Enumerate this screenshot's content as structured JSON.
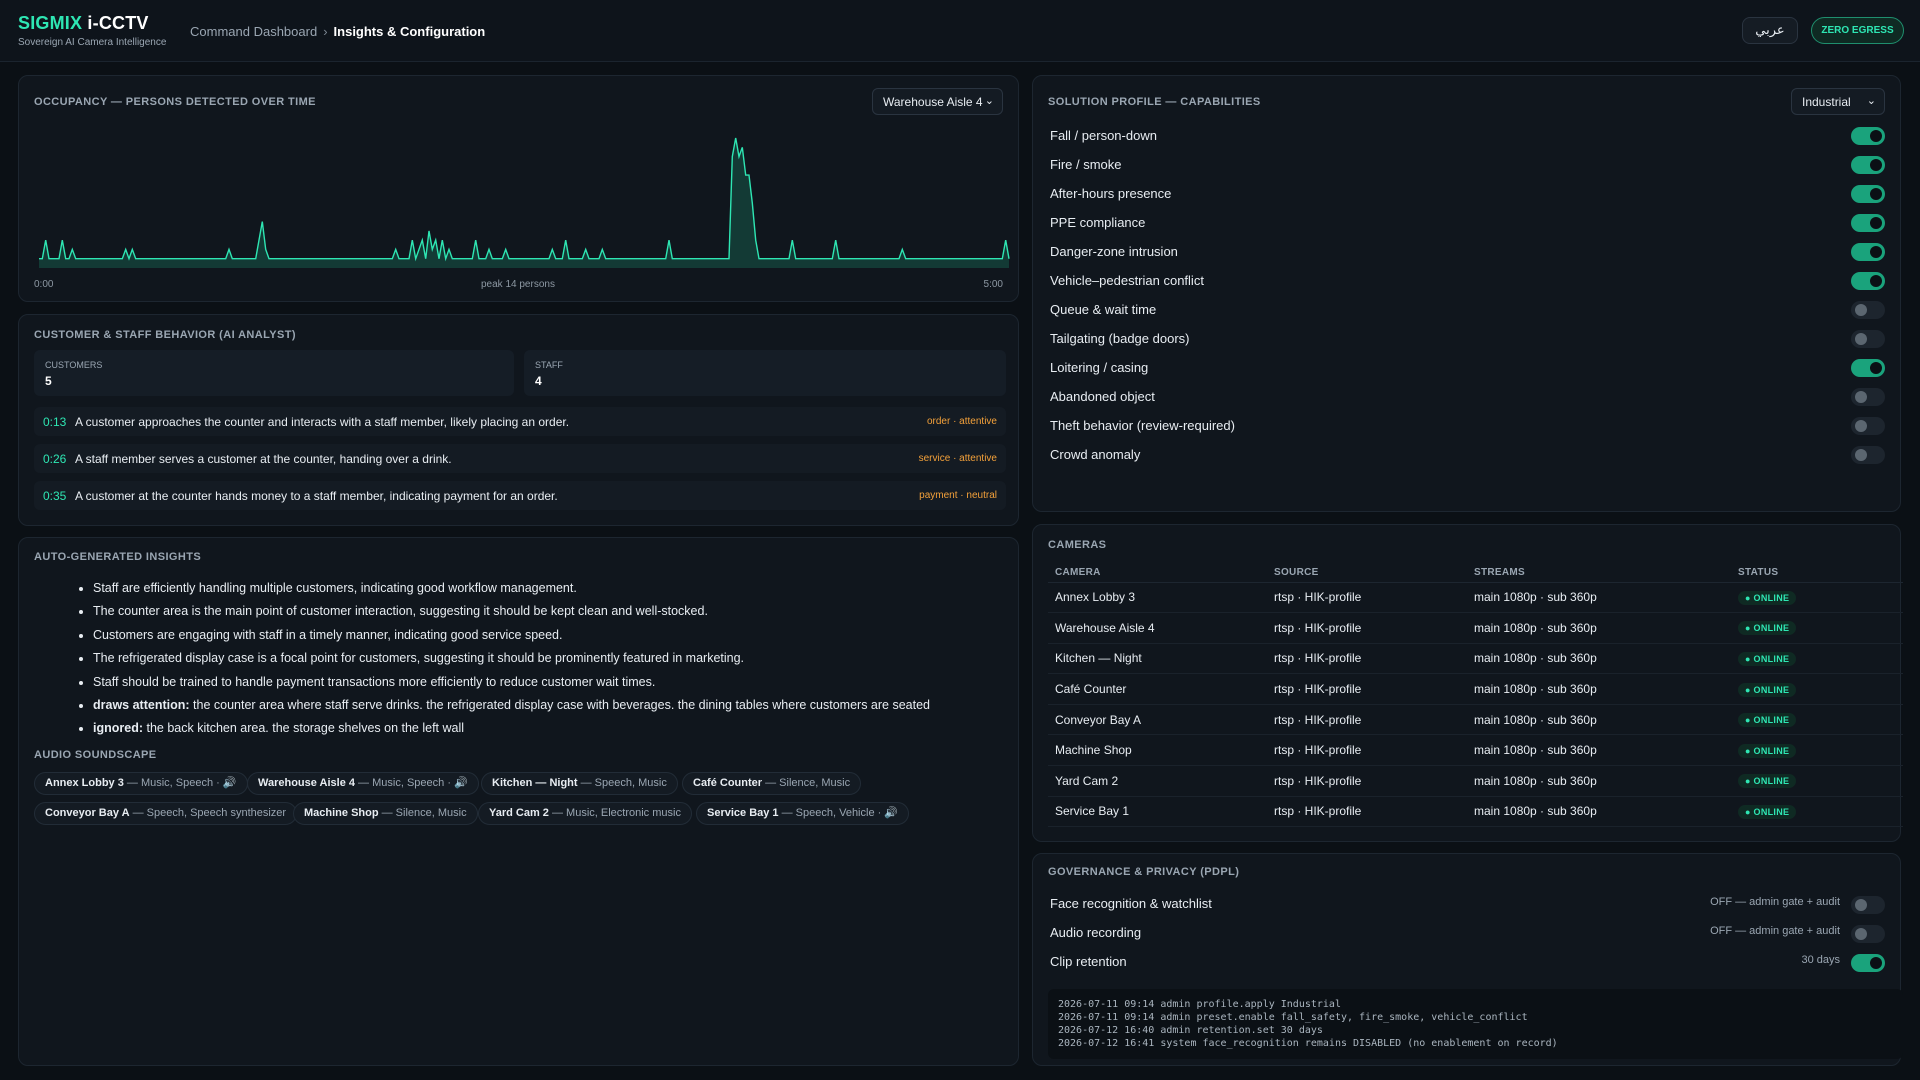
{
  "app": {
    "brand_accent": "SIGMIX",
    "brand_rest": " i-CCTV",
    "tagline": "Sovereign AI Camera Intelligence"
  },
  "breadcrumb": {
    "parent": "Command Dashboard",
    "separator": "›",
    "current": "Insights & Configuration"
  },
  "header": {
    "lang_button": "عربي",
    "zero_egress": "ZERO EGRESS"
  },
  "colors": {
    "accent": "#2ee6b3",
    "warn": "#f4a13a",
    "bg": "#0b1015",
    "panel": "#10161d"
  },
  "occupancy": {
    "title": "OCCUPANCY — PERSONS DETECTED OVER TIME",
    "camera_select": "Warehouse Aisle 4",
    "x_start": "0:00",
    "x_end": "5:00",
    "peak_label": "peak 14 persons"
  },
  "chart_data": {
    "type": "area",
    "title": "OCCUPANCY — PERSONS DETECTED OVER TIME",
    "x_range": [
      "0:00",
      "5:00"
    ],
    "ylim": [
      0,
      14
    ],
    "grid": false,
    "series": [
      {
        "values": [
          1,
          1,
          3,
          1,
          1,
          1,
          1,
          3,
          1,
          1,
          2,
          1,
          1,
          1,
          1,
          1,
          1,
          1,
          1,
          1,
          1,
          1,
          1,
          1,
          1,
          1,
          2,
          1,
          2,
          1,
          1,
          1,
          1,
          1,
          1,
          1,
          1,
          1,
          1,
          1,
          1,
          1,
          1,
          1,
          1,
          1,
          1,
          1,
          1,
          1,
          1,
          1,
          1,
          1,
          1,
          1,
          1,
          2,
          1,
          1,
          1,
          1,
          1,
          1,
          1,
          1,
          3,
          5,
          2,
          1,
          1,
          1,
          1,
          1,
          1,
          1,
          1,
          1,
          1,
          1,
          1,
          1,
          1,
          1,
          1,
          1,
          1,
          1,
          1,
          1,
          1,
          1,
          1,
          1,
          1,
          1,
          1,
          1,
          1,
          1,
          1,
          1,
          1,
          1,
          1,
          1,
          1,
          2,
          1,
          1,
          1,
          1,
          3,
          1,
          2,
          3,
          1,
          4,
          2,
          3,
          1,
          3,
          1,
          2,
          1,
          1,
          1,
          1,
          1,
          1,
          1,
          3,
          1,
          1,
          1,
          2,
          1,
          1,
          1,
          1,
          2,
          1,
          1,
          1,
          1,
          1,
          1,
          1,
          1,
          1,
          1,
          1,
          1,
          1,
          2,
          1,
          1,
          1,
          3,
          1,
          1,
          1,
          1,
          1,
          2,
          1,
          1,
          1,
          1,
          2,
          1,
          1,
          1,
          1,
          1,
          1,
          1,
          1,
          1,
          1,
          1,
          1,
          1,
          1,
          1,
          1,
          1,
          1,
          1,
          3,
          1,
          1,
          1,
          1,
          1,
          1,
          1,
          1,
          1,
          1,
          1,
          1,
          1,
          1,
          1,
          1,
          1,
          1,
          12,
          14,
          12,
          13,
          10,
          10,
          7,
          3,
          1,
          1,
          1,
          1,
          1,
          1,
          1,
          1,
          1,
          1,
          3,
          1,
          1,
          1,
          1,
          1,
          1,
          1,
          1,
          1,
          1,
          1,
          1,
          3,
          1,
          1,
          1,
          1,
          1,
          1,
          1,
          1,
          1,
          1,
          1,
          1,
          1,
          1,
          1,
          1,
          1,
          1,
          1,
          2,
          1,
          1,
          1,
          1,
          1,
          1,
          1,
          1,
          1,
          1,
          1,
          1,
          1,
          1,
          1,
          1,
          1,
          1,
          1,
          1,
          1,
          1,
          1,
          1,
          1,
          1,
          1,
          1,
          1,
          1,
          3,
          1
        ]
      }
    ]
  },
  "behavior": {
    "title": "CUSTOMER & STAFF BEHAVIOR (AI ANALYST)",
    "customers_label": "CUSTOMERS",
    "customers": "5",
    "staff_label": "STAFF",
    "staff": "4",
    "events": [
      {
        "time": "0:13",
        "text": "A customer approaches the counter and interacts with a staff member, likely placing an order.",
        "tag": "order · attentive"
      },
      {
        "time": "0:26",
        "text": "A staff member serves a customer at the counter, handing over a drink.",
        "tag": "service · attentive"
      },
      {
        "time": "0:35",
        "text": "A customer at the counter hands money to a staff member, indicating payment for an order.",
        "tag": "payment · neutral"
      }
    ]
  },
  "insights": {
    "title": "AUTO-GENERATED INSIGHTS",
    "items": [
      "Staff are efficiently handling multiple customers, indicating good workflow management.",
      "The counter area is the main point of customer interaction, suggesting it should be kept clean and well-stocked.",
      "Customers are engaging with staff in a timely manner, indicating good service speed.",
      "The refrigerated display case is a focal point for customers, suggesting it should be prominently featured in marketing.",
      "Staff should be trained to handle payment transactions more efficiently to reduce customer wait times."
    ],
    "attention_label": "draws attention:",
    "attention_text": " the counter area where staff serve drinks. the refrigerated display case with beverages. the dining tables where customers are seated",
    "ignored_label": "ignored:",
    "ignored_text": " the back kitchen area. the storage shelves on the left wall",
    "audio_title": "AUDIO SOUNDSCAPE",
    "audio_chips": [
      {
        "cam": "Annex Lobby 3",
        "tags": " — Music, Speech · 🔊"
      },
      {
        "cam": "Warehouse Aisle 4",
        "tags": " — Music, Speech · 🔊"
      },
      {
        "cam": "Kitchen — Night",
        "tags": " — Speech, Music"
      },
      {
        "cam": "Café Counter",
        "tags": " — Silence, Music"
      },
      {
        "cam": "Conveyor Bay A",
        "tags": " — Speech, Speech synthesizer"
      },
      {
        "cam": "Machine Shop",
        "tags": " — Silence, Music"
      },
      {
        "cam": "Yard Cam 2",
        "tags": " — Music, Electronic music"
      },
      {
        "cam": "Service Bay 1",
        "tags": " — Speech, Vehicle · 🔊"
      }
    ]
  },
  "profile": {
    "title": "SOLUTION PROFILE — CAPABILITIES",
    "select": "Industrial",
    "capabilities": [
      {
        "label": "Fall / person-down",
        "on": true
      },
      {
        "label": "Fire / smoke",
        "on": true
      },
      {
        "label": "After-hours presence",
        "on": true
      },
      {
        "label": "PPE compliance",
        "on": true
      },
      {
        "label": "Danger-zone intrusion",
        "on": true
      },
      {
        "label": "Vehicle–pedestrian conflict",
        "on": true
      },
      {
        "label": "Queue & wait time",
        "on": false
      },
      {
        "label": "Tailgating (badge doors)",
        "on": false
      },
      {
        "label": "Loitering / casing",
        "on": true
      },
      {
        "label": "Abandoned object",
        "on": false
      },
      {
        "label": "Theft behavior (review-required)",
        "on": false
      },
      {
        "label": "Crowd anomaly",
        "on": false
      }
    ]
  },
  "cameras": {
    "title": "CAMERAS",
    "headers": [
      "CAMERA",
      "SOURCE",
      "STREAMS",
      "STATUS"
    ],
    "rows": [
      [
        "Annex Lobby 3",
        "rtsp · HIK-profile",
        "main 1080p · sub 360p",
        "● ONLINE"
      ],
      [
        "Warehouse Aisle 4",
        "rtsp · HIK-profile",
        "main 1080p · sub 360p",
        "● ONLINE"
      ],
      [
        "Kitchen — Night",
        "rtsp · HIK-profile",
        "main 1080p · sub 360p",
        "● ONLINE"
      ],
      [
        "Café Counter",
        "rtsp · HIK-profile",
        "main 1080p · sub 360p",
        "● ONLINE"
      ],
      [
        "Conveyor Bay A",
        "rtsp · HIK-profile",
        "main 1080p · sub 360p",
        "● ONLINE"
      ],
      [
        "Machine Shop",
        "rtsp · HIK-profile",
        "main 1080p · sub 360p",
        "● ONLINE"
      ],
      [
        "Yard Cam 2",
        "rtsp · HIK-profile",
        "main 1080p · sub 360p",
        "● ONLINE"
      ],
      [
        "Service Bay 1",
        "rtsp · HIK-profile",
        "main 1080p · sub 360p",
        "● ONLINE"
      ]
    ]
  },
  "governance": {
    "title": "GOVERNANCE & PRIVACY (PDPL)",
    "items": [
      {
        "label": "Face recognition & watchlist",
        "status": "OFF — admin gate + audit",
        "on": false
      },
      {
        "label": "Audio recording",
        "status": "OFF — admin gate + audit",
        "on": false
      },
      {
        "label": "Clip retention",
        "status": "30 days",
        "on": true
      }
    ],
    "log": [
      "2026-07-11 09:14 admin profile.apply Industrial",
      "2026-07-11 09:14 admin preset.enable fall_safety, fire_smoke, vehicle_conflict",
      "2026-07-12 16:40 admin retention.set 30 days",
      "2026-07-12 16:41 system face_recognition remains DISABLED (no enablement on record)"
    ]
  }
}
